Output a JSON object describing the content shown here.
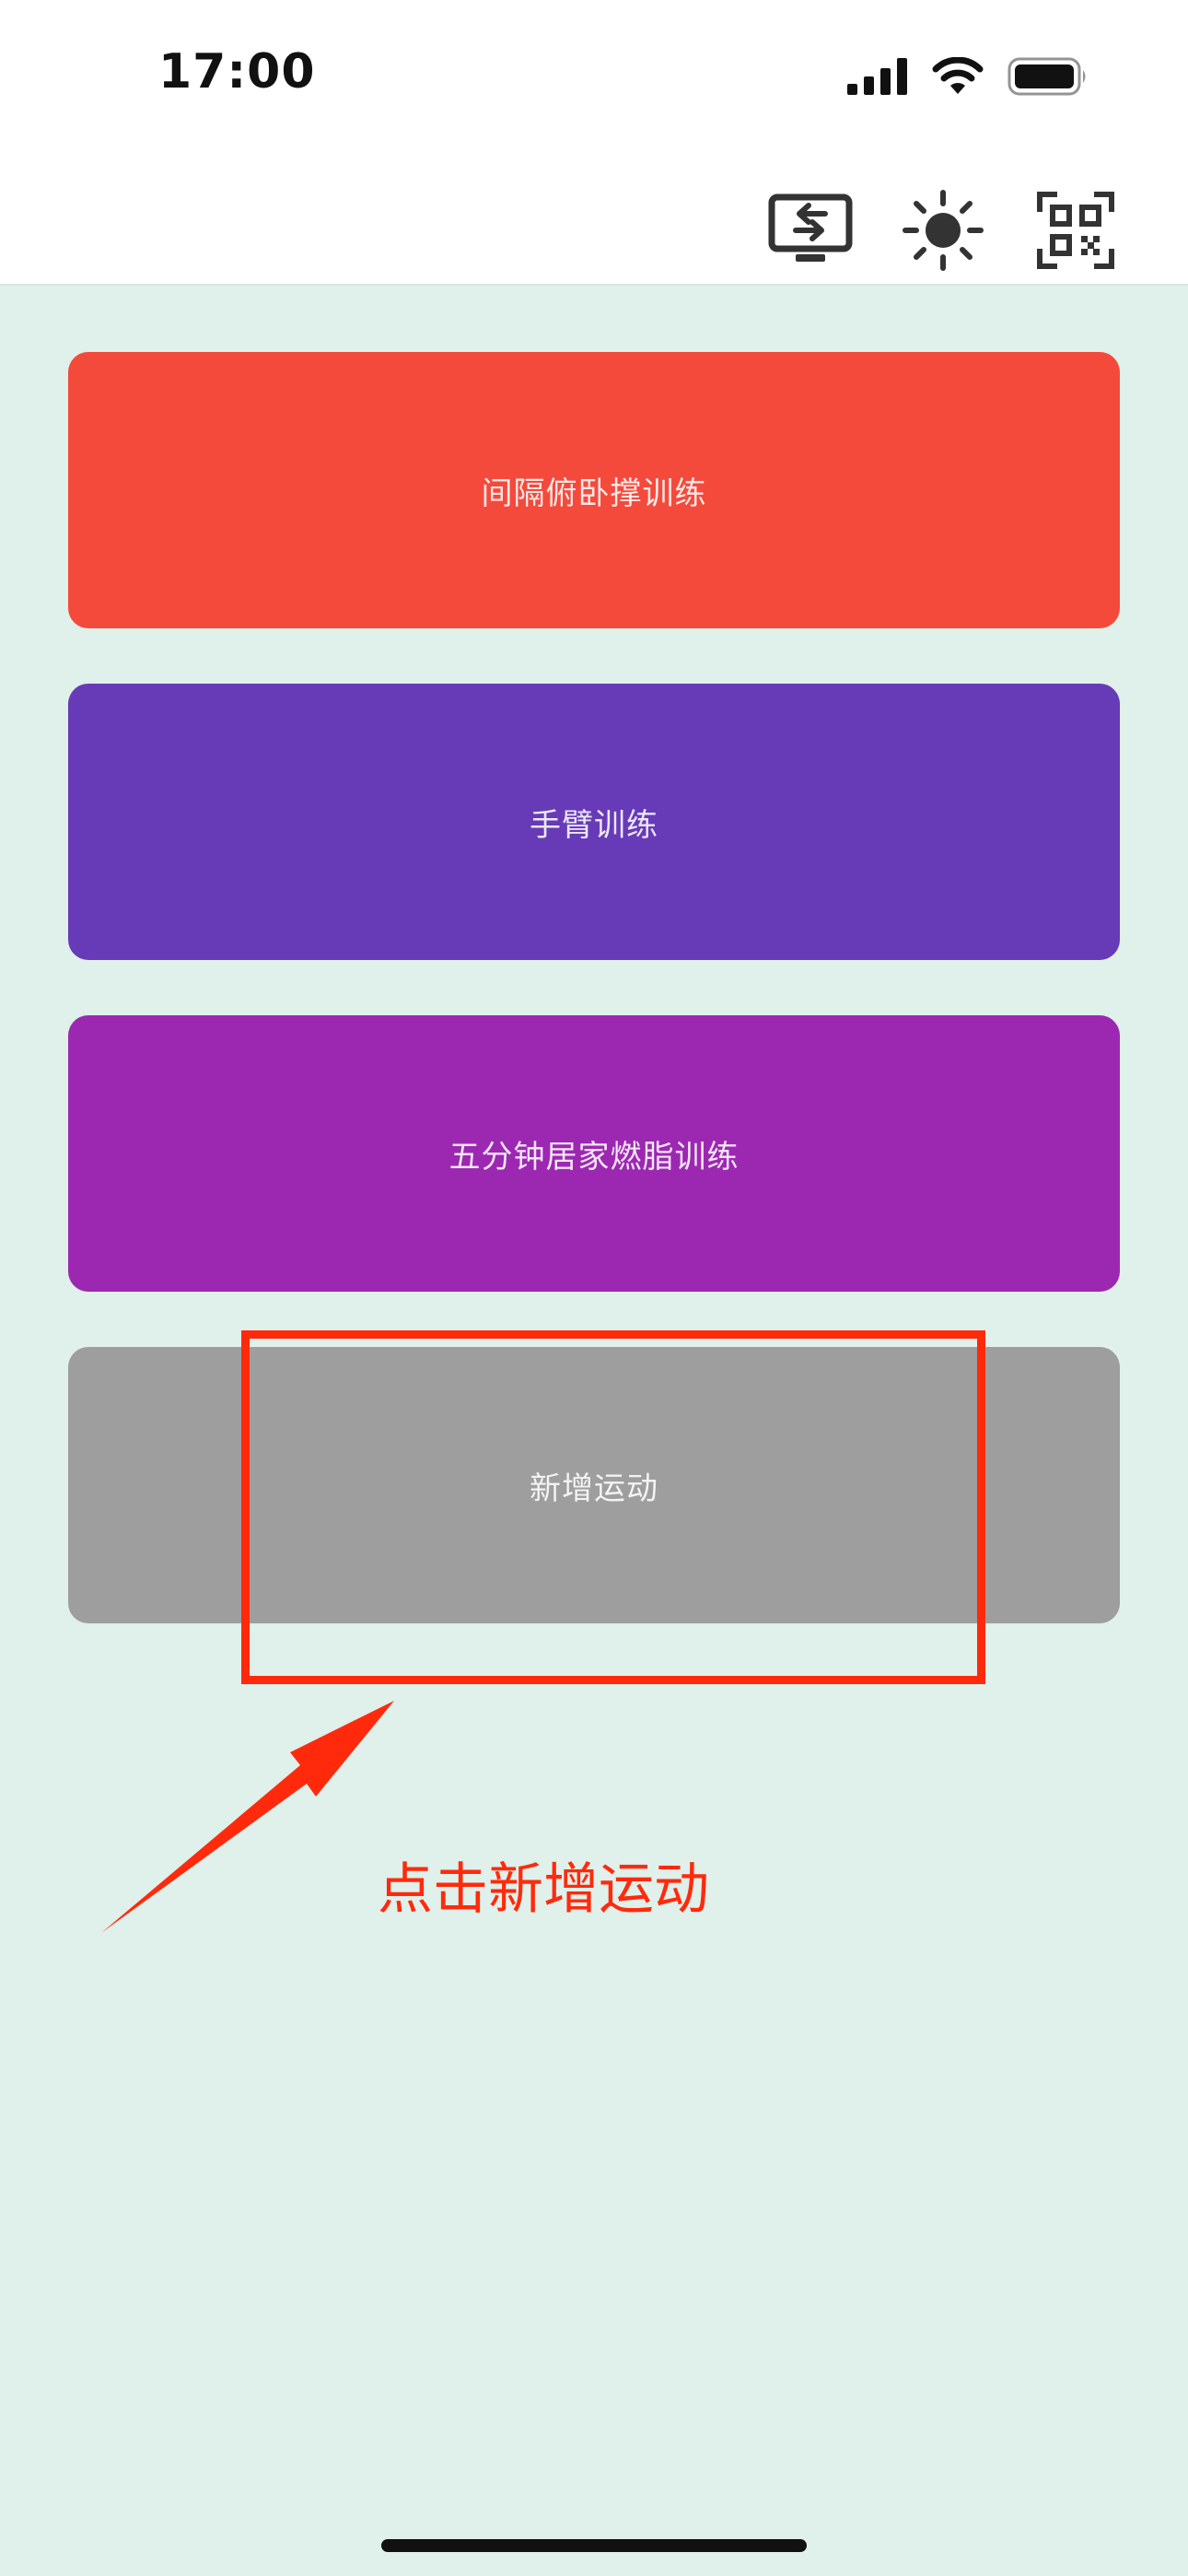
{
  "status_bar": {
    "time": "17:00",
    "icons": [
      "cellular-signal-icon",
      "wifi-icon",
      "battery-icon"
    ]
  },
  "toolbar": {
    "buttons": [
      {
        "icon": "screen-switch-icon"
      },
      {
        "icon": "brightness-icon"
      },
      {
        "icon": "qr-scan-icon"
      }
    ]
  },
  "workouts": [
    {
      "label": "间隔俯卧撑训练",
      "color": "#f44a3c"
    },
    {
      "label": "手臂训练",
      "color": "#673bb7"
    },
    {
      "label": "五分钟居家燃脂训练",
      "color": "#9c28b1"
    },
    {
      "label": "新增运动",
      "color": "#9e9e9e"
    }
  ],
  "annotation": {
    "text": "点击新增运动",
    "color": "#ff2a0c"
  }
}
